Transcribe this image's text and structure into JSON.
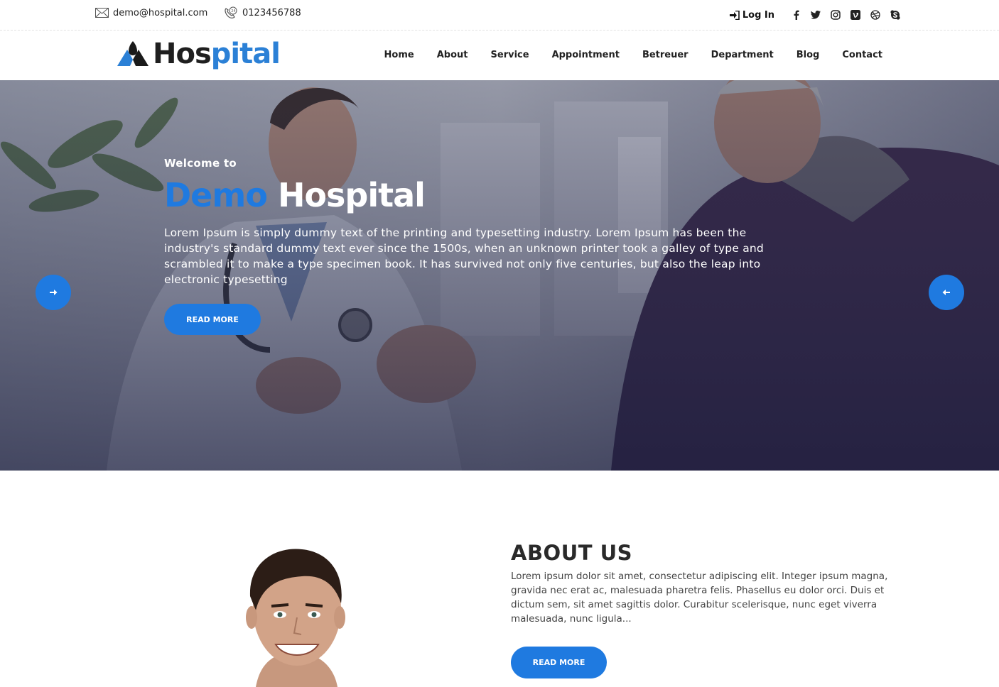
{
  "topbar": {
    "email": "demo@hospital.com",
    "phone": "0123456788",
    "login_label": "Log In",
    "social_icons": [
      "facebook-icon",
      "twitter-icon",
      "instagram-icon",
      "vimeo-icon",
      "dribbble-icon",
      "skype-icon"
    ]
  },
  "brand": {
    "logo_text_dark": "Hos",
    "logo_text_blue": "pital"
  },
  "nav": {
    "items": [
      "Home",
      "About",
      "Service",
      "Appointment",
      "Betreuer",
      "Department",
      "Blog",
      "Contact"
    ]
  },
  "hero": {
    "welcome": "Welcome to",
    "title_accent": "Demo",
    "title_rest": "Hospital",
    "description": "Lorem Ipsum is simply dummy text of the printing and typesetting industry. Lorem Ipsum has been the industry's standard dummy text ever since the 1500s, when an unknown printer took a galley of type and scrambled it to make a type specimen book. It has survived not only five centuries, but also the leap into electronic typesetting",
    "button_label": "READ MORE"
  },
  "about": {
    "title": "ABOUT US",
    "text": "Lorem ipsum dolor sit amet, consectetur adipiscing elit. Integer ipsum magna, gravida nec erat ac, malesuada pharetra felis. Phasellus eu dolor orci. Duis et dictum sem, sit amet sagittis dolor. Curabitur scelerisque, nunc eget viverra malesuada, nunc ligula...",
    "button_label": "READ MORE"
  },
  "colors": {
    "accent": "#1f7ae0",
    "logo_blue": "#2b80d6",
    "text_dark": "#222222"
  }
}
